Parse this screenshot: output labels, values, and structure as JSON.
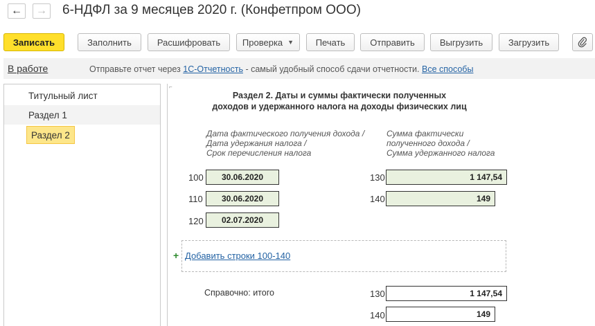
{
  "header": {
    "back_icon": "←",
    "forward_icon": "→",
    "title": "6-НДФЛ за 9 месяцев 2020 г. (Конфетпром ООО)"
  },
  "toolbar": {
    "save": "Записать",
    "fill": "Заполнить",
    "decode": "Расшифровать",
    "check": "Проверка",
    "print": "Печать",
    "send": "Отправить",
    "export": "Выгрузить",
    "import": "Загрузить",
    "attach_icon": "paperclip-icon"
  },
  "infobar": {
    "status": "В работе",
    "text_before": "Отправьте отчет через ",
    "link_service": "1С-Отчетность",
    "text_after": " - самый удобный способ сдачи отчетности. ",
    "link_all": "Все способы"
  },
  "sidebar": {
    "items": [
      {
        "label": "Титульный лист"
      },
      {
        "label": "Раздел 1"
      },
      {
        "label": "Раздел 2"
      }
    ]
  },
  "section": {
    "title_line1": "Раздел 2.  Даты и суммы фактически полученных",
    "title_line2": "доходов и удержанного налога на доходы физических лиц",
    "left_head_1": "Дата фактического получения дохода /",
    "left_head_2": "Дата удержания налога /",
    "left_head_3": "Срок перечисления налога",
    "right_head_1": "Сумма фактически",
    "right_head_2": "полученного дохода /",
    "right_head_3": "Сумма удержанного налога",
    "rows": {
      "code100": "100",
      "val100": "30.06.2020",
      "code110": "110",
      "val110": "30.06.2020",
      "code120": "120",
      "val120": "02.07.2020",
      "code130": "130",
      "val130": "1 147,54",
      "code140": "140",
      "val140": "149"
    },
    "add_plus": "+",
    "add_rows": "Добавить строки 100-140",
    "ref_label": "Справочно: итого",
    "ref": {
      "code130": "130",
      "val130": "1 147,54",
      "code140": "140",
      "val140": "149"
    }
  }
}
